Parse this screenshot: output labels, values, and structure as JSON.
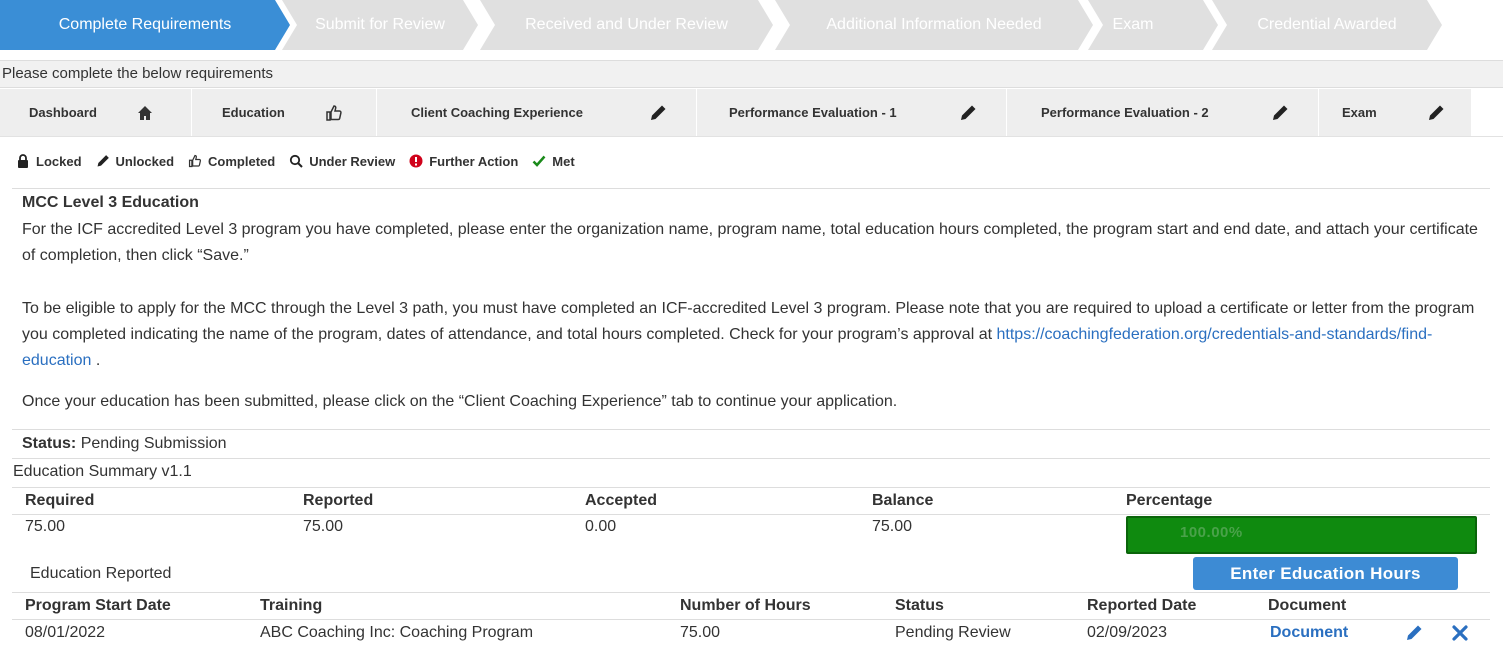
{
  "steps": [
    {
      "label": "Complete Requirements",
      "active": true
    },
    {
      "label": "Submit for Review",
      "active": false
    },
    {
      "label": "Received and Under Review",
      "active": false
    },
    {
      "label": "Additional Information Needed",
      "active": false
    },
    {
      "label": "Exam",
      "active": false
    },
    {
      "label": "Credential Awarded",
      "active": false
    }
  ],
  "colors": {
    "active_step": "#3a8ed6",
    "inactive_step": "#e0e0e0",
    "link": "#2a6fc0",
    "progress": "#0f8a0f",
    "button": "#3d8bd4"
  },
  "instruction": "Please complete the below requirements",
  "tabs": [
    {
      "label": "Dashboard",
      "icon": "home-icon"
    },
    {
      "label": "Education",
      "icon": "thumbs-up-icon"
    },
    {
      "label": "Client Coaching Experience",
      "icon": "pencil-icon"
    },
    {
      "label": "Performance Evaluation - 1",
      "icon": "pencil-icon"
    },
    {
      "label": "Performance Evaluation - 2",
      "icon": "pencil-icon"
    },
    {
      "label": "Exam",
      "icon": "pencil-icon"
    }
  ],
  "legend": [
    {
      "label": "Locked",
      "icon": "lock-icon"
    },
    {
      "label": "Unlocked",
      "icon": "pencil-icon"
    },
    {
      "label": "Completed",
      "icon": "thumbs-up-icon"
    },
    {
      "label": "Under Review",
      "icon": "search-icon"
    },
    {
      "label": "Further Action",
      "icon": "exclamation-icon"
    },
    {
      "label": "Met",
      "icon": "check-icon"
    }
  ],
  "section": {
    "title": "MCC Level 3 Education",
    "para1": "For the ICF accredited Level 3 program you have completed, please enter the organization name, program name, total education hours completed, the program start and end date, and attach your certificate of completion, then click “Save.”",
    "para2_text": "To be eligible to apply for the MCC through the Level 3 path, you must have completed an ICF-accredited Level 3 program. Please note that you are required to upload a certificate or letter from the program you completed indicating the name of the program, dates of attendance, and total hours completed. Check for your program’s approval at ",
    "para2_link": "https://coachingfederation.org/credentials-and-standards/find-education",
    "para2_end": " .",
    "para3": "Once your education has been submitted, please click on the “Client Coaching Experience” tab to continue your application."
  },
  "status": {
    "label": "Status:",
    "value": "Pending Submission"
  },
  "summary": {
    "title": "Education Summary v1.1",
    "headers": [
      "Required",
      "Reported",
      "Accepted",
      "Balance",
      "Percentage"
    ],
    "values": [
      "75.00",
      "75.00",
      "0.00",
      "75.00"
    ],
    "percentage_text": "100.00%",
    "percentage": 100
  },
  "reported": {
    "title": "Education Reported",
    "button": "Enter Education Hours",
    "headers": [
      "Program Start Date",
      "Training",
      "Number of Hours",
      "Status",
      "Reported Date",
      "Document"
    ],
    "rows": [
      {
        "start": "08/01/2022",
        "training": "ABC Coaching Inc: Coaching Program",
        "hours": "75.00",
        "status": "Pending Review",
        "reported": "02/09/2023",
        "document": "Document"
      }
    ]
  }
}
